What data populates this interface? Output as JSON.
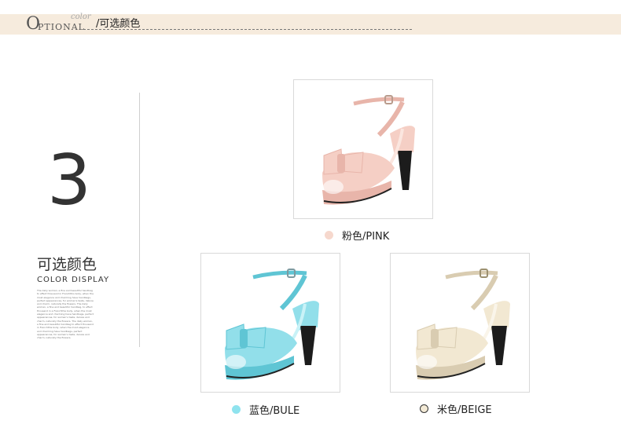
{
  "header": {
    "logo_initial": "O",
    "logo_rest": "PTIONAL",
    "logo_script": "color",
    "title": "/可选颜色"
  },
  "section": {
    "number": "3",
    "title_cn": "可选颜色",
    "title_en": "COLOR DISPLAY",
    "fine_print": "The daily woman, a fine and beautiful handbag to effect thousand in Franchthis body, when the most elegance and charming have handbags, perfect appearances, for woman's taste, deluxe and charm, naturally the flowers. The daily woman, a fine and beautiful handbag, to effect thousand in a Franchthis body, when the most elegance and charming have handbags, perfect appearances, for woman's taste, deluxe and charm, naturally the flowers. The daily woman, a fine and beautiful handbag to effect thousand in Franchthis body, when the most elegance and charming have handbags, perfect appearances, for woman's taste, deluxe and charm, naturally the flowers."
  },
  "variants": [
    {
      "label": "粉色/PINK",
      "swatch": "#f6d8cd",
      "shoe": "#f5cfc5",
      "shoe_shade": "#e8b5aa",
      "sole": "#e9c0b5"
    },
    {
      "label": "蓝色/BULE",
      "swatch": "#8fe3ee",
      "shoe": "#92dfea",
      "shoe_shade": "#5fc5d4",
      "sole": "#7fd0dc"
    },
    {
      "label": "米色/BEIGE",
      "swatch": "#f3ead6",
      "shoe": "#f2e8d2",
      "shoe_shade": "#d9ccb1",
      "sole": "#e6dcc4"
    }
  ]
}
